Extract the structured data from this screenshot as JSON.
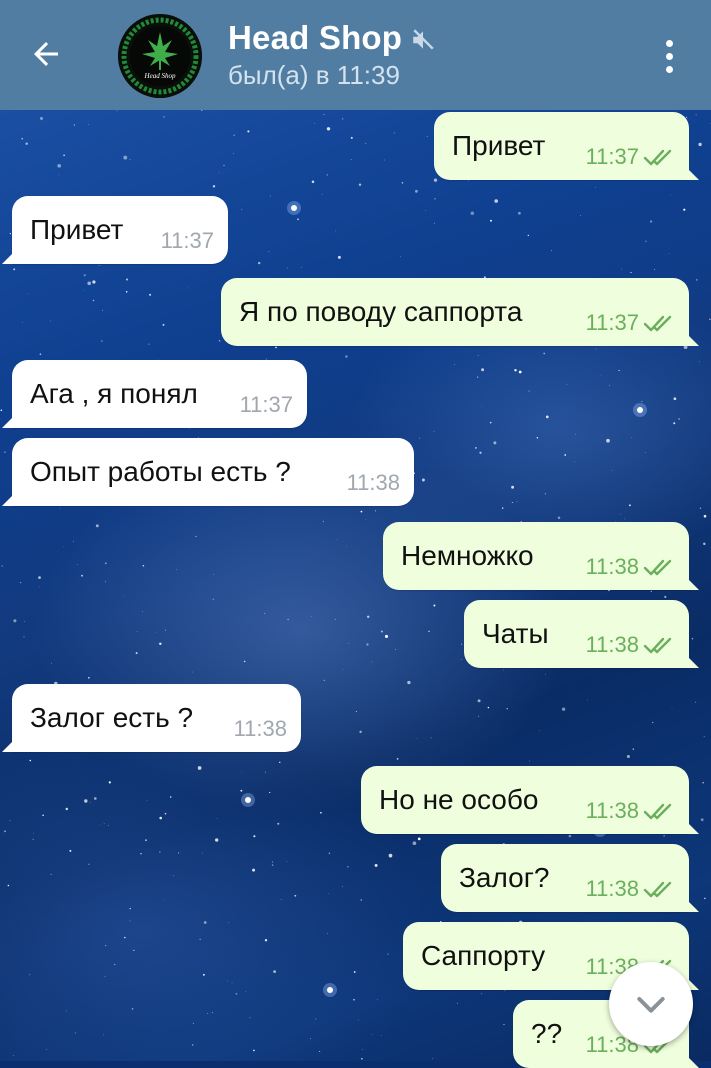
{
  "header": {
    "title": "Head Shop",
    "status": "был(а) в 11:39",
    "avatar_text": "Head Shop",
    "icons": {
      "back": "arrow-left-icon",
      "mute": "speaker-muted-icon",
      "menu": "more-vertical-icon"
    }
  },
  "colors": {
    "header": "#527da3",
    "incoming_bubble": "#ffffff",
    "outgoing_bubble": "#effedd",
    "outgoing_time": "#6ab05c",
    "incoming_time": "#a0a7ae"
  },
  "messages": [
    {
      "dir": "out",
      "text": "Привет",
      "time": "11:37",
      "read": true
    },
    {
      "dir": "in",
      "text": "Привет",
      "time": "11:37"
    },
    {
      "dir": "out",
      "text": "Я по поводу саппорта",
      "time": "11:37",
      "read": true
    },
    {
      "dir": "in",
      "text": "Ага , я понял",
      "time": "11:37"
    },
    {
      "dir": "in",
      "text": "Опыт работы есть ?",
      "time": "11:38"
    },
    {
      "dir": "out",
      "text": "Немножко",
      "time": "11:38",
      "read": true
    },
    {
      "dir": "out",
      "text": "Чаты",
      "time": "11:38",
      "read": true
    },
    {
      "dir": "in",
      "text": "Залог есть ?",
      "time": "11:38"
    },
    {
      "dir": "out",
      "text": "Но не особо",
      "time": "11:38",
      "read": true
    },
    {
      "dir": "out",
      "text": "Залог?",
      "time": "11:38",
      "read": true
    },
    {
      "dir": "out",
      "text": "Саппорту",
      "time": "11:38",
      "read": true
    },
    {
      "dir": "out",
      "text": "??",
      "time": "11:38",
      "read": true
    }
  ],
  "scroll_button": {
    "icon": "chevron-down-icon"
  }
}
